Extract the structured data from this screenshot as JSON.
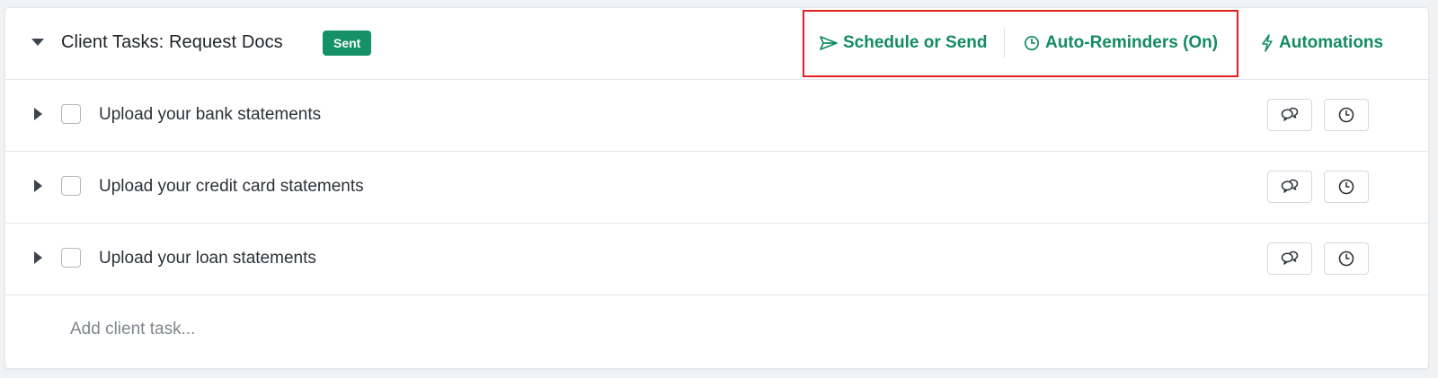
{
  "header": {
    "title": "Client Tasks: Request Docs",
    "status_badge": "Sent",
    "actions": {
      "schedule_label": "Schedule or Send",
      "reminders_label": "Auto-Reminders (On)",
      "automations_label": "Automations"
    }
  },
  "tasks": [
    {
      "label": "Upload your bank statements"
    },
    {
      "label": "Upload your credit card statements"
    },
    {
      "label": "Upload your loan statements"
    }
  ],
  "add_task": {
    "placeholder": "Add client task..."
  },
  "icons": {
    "collapse": "caret-down-icon",
    "expand": "caret-right-icon",
    "schedule": "send-icon",
    "reminders": "clock-icon",
    "automations": "lightning-icon",
    "comment": "chat-bubbles-icon",
    "clock": "clock-icon"
  },
  "colors": {
    "accent": "#138b63",
    "badge_bg": "#149167",
    "highlight_border": "#e32020"
  }
}
